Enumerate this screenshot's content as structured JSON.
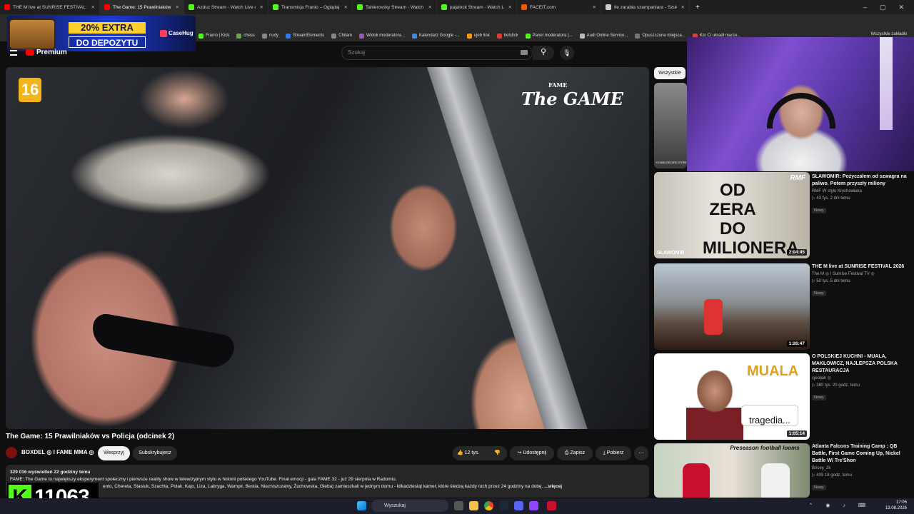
{
  "browser": {
    "tabs": [
      {
        "label": "THE M live at SUNRISE FESTIVAL 2026",
        "color": "#ff0000",
        "active": false
      },
      {
        "label": "The Game: 15 Prawilniaków vs Policja",
        "color": "#ff0000",
        "active": true
      },
      {
        "label": "Azduz Stream - Watch Live on Kick",
        "color": "#53fc18",
        "active": false
      },
      {
        "label": "Transmisja Franio – Oglądaj na żywo",
        "color": "#53fc18",
        "active": false
      },
      {
        "label": "Tahlerovsky Stream - Watch Live on",
        "color": "#53fc18",
        "active": false
      },
      {
        "label": "pajalock Stream - Watch Live on",
        "color": "#53fc18",
        "active": false
      },
      {
        "label": "FACEIT.com",
        "color": "#ff5500",
        "active": false
      },
      {
        "label": "Ile zarabia szampaniara - Szukaj",
        "color": "#cccccc",
        "active": false
      }
    ],
    "new_tab": "+",
    "window_controls": [
      "–",
      "▢",
      "✕"
    ],
    "bookmarks": [
      "Franio | Kick",
      "chess",
      "nudy",
      "StreamElements",
      "Chilam",
      "Widok moderatora...",
      "Kalendarz Google -...",
      "ujeb link",
      "betclick",
      "Panel moderatora |...",
      "Audi Online Service...",
      "Opuszczone miejsca...",
      "Kto Ci ukradł marze..."
    ],
    "bookmarks_right": "Wszystkie zakładki"
  },
  "ad": {
    "extra": "20% EXTRA",
    "deposit": "DO DEPOZYTU",
    "brand": "CaseHug"
  },
  "youtube": {
    "logo_suffix": "Premium",
    "search_placeholder": "Szukaj"
  },
  "video": {
    "age_rating": "16",
    "logo_small": "FAME",
    "logo_main": "The GAME",
    "title": "The Game: 15 Prawilniaków vs Policja (odcinek 2)",
    "channel": "BOXDEL ◎ I FAME MMA ◎",
    "support": "Wesprzyj",
    "subscribed": "Subskrybujesz",
    "likes": "12 tys.",
    "share": "Udostępnij",
    "save": "Zapisz",
    "download": "Pobierz",
    "more": "···",
    "views_date": "329 016 wyświetleń  22 godziny temu",
    "desc_line1": "FAME: The Game to największy eksperyment społeczny i pierwsze reality show w telewizyjnym stylu w historii polskiego YouTube. Finał emocji - gala FAME 32 - już 29 sierpnia w Radomiu.",
    "desc_line2": "ento, Chereta, Stasiuk, Szachta, Polak, Kajo, Liza, Labryga, Wampir, Bestia, Niezniszczalny, Żuchowska, Gleba) zamieszkali w jednym domu - kilkadziesiąt kamer, które śledzą każdy ruch przez 24 godziny na dobę.",
    "more_link": "...więcej"
  },
  "sidebar": {
    "filter_chip": "Wszystkie",
    "first_thumb_caption": "YOYABU RECORD STORE",
    "items": [
      {
        "title": "SŁAWOMIR: Pożyczałem od szwagra na paliwo. Potem przyszły miliony",
        "channel": "RMF W stylu Krychowiaka",
        "views": "▷ 43 tys.  2 dni temu",
        "badge": "Nowy",
        "duration": "2:04:45",
        "thumb_text": "OD ZERA DO MILIONERA",
        "thumb_label": "SŁAWOMIR",
        "thumb_logo": "RMF"
      },
      {
        "title": "THE M live at SUNRISE FESTIVAL 2026",
        "channel": "The M ◎ I Sunrise Festival TV ◎",
        "views": "▷ 50 tys.  5 dni temu",
        "badge": "Nowy",
        "duration": "1:26:47"
      },
      {
        "title": "O POLSKIEJ KUCHNI - MUALA, MAKŁOWICZ, NAJLEPSZA POLSKA RESTAURACJA",
        "channel": "cjeoljak ◎",
        "views": "▷ 380 tys.  20 godz. temu",
        "badge": "Nowy",
        "duration": "1:05:14",
        "thumb_text": "MUALA",
        "thumb_caption": "tragedia..."
      },
      {
        "title": "Atlanta Falcons Training Camp : QB Battle, First Game Coming Up, Nickel Battle W/ Tre'Shon",
        "channel": "Bricey_2k",
        "views": "▷ 409  18 godz. temu",
        "badge": "Nowy",
        "thumb_text": "Preseason football looms"
      }
    ]
  },
  "kick": {
    "letter": "K",
    "count": "11063"
  },
  "taskbar": {
    "search": "Wyszukaj",
    "time": "17:05",
    "date": "13.08.2026"
  }
}
